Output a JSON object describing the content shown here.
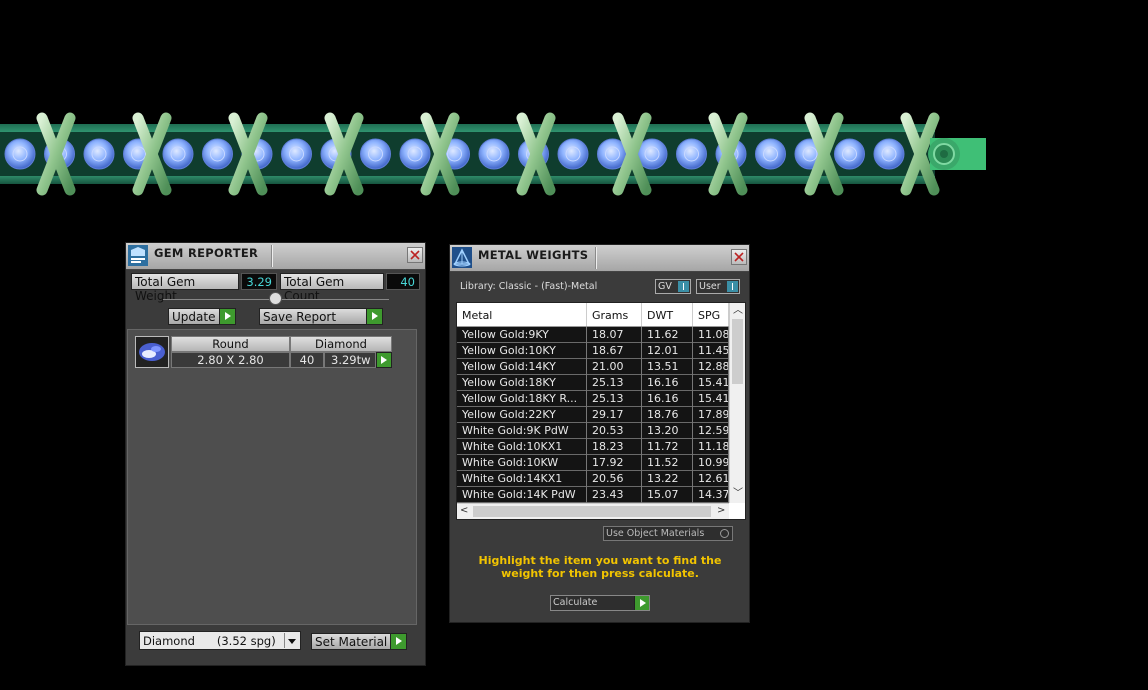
{
  "gem_reporter": {
    "title": "GEM REPORTER",
    "total_weight_label": "Total Gem Weight",
    "total_weight_value": "3.29",
    "total_count_label": "Total Gem Count",
    "total_count_value": "40",
    "update_label": "Update",
    "save_report_label": "Save Report",
    "gems": [
      {
        "shape": "Round",
        "material": "Diamond",
        "size": "2.80 X 2.80",
        "count": "40",
        "weight": "3.29tw"
      }
    ],
    "material_select": "Diamond      (3.52 spg)",
    "set_material_label": "Set Material"
  },
  "metal_weights": {
    "title": "METAL WEIGHTS",
    "library": "Library: Classic - (Fast)-Metal",
    "gv_label": "GV",
    "user_label": "User",
    "columns": [
      "Metal",
      "Grams",
      "DWT",
      "SPG"
    ],
    "rows": [
      [
        "Yellow Gold:9KY",
        "18.07",
        "11.62",
        "11.08"
      ],
      [
        "Yellow Gold:10KY",
        "18.67",
        "12.01",
        "11.45"
      ],
      [
        "Yellow Gold:14KY",
        "21.00",
        "13.51",
        "12.88"
      ],
      [
        "Yellow Gold:18KY",
        "25.13",
        "16.16",
        "15.41"
      ],
      [
        "Yellow Gold:18KY R...",
        "25.13",
        "16.16",
        "15.41"
      ],
      [
        "Yellow Gold:22KY",
        "29.17",
        "18.76",
        "17.89"
      ],
      [
        "White Gold:9K PdW",
        "20.53",
        "13.20",
        "12.59"
      ],
      [
        "White Gold:10KX1",
        "18.23",
        "11.72",
        "11.18"
      ],
      [
        "White Gold:10KW",
        "17.92",
        "11.52",
        "10.99"
      ],
      [
        "White Gold:14KX1",
        "20.56",
        "13.22",
        "12.61"
      ],
      [
        "White Gold:14K PdW",
        "23.43",
        "15.07",
        "14.37"
      ]
    ],
    "use_object_materials_label": "Use Object Materials",
    "instruction": "Highlight the item you want to find the weight for then press calculate.",
    "calculate_label": "Calculate"
  },
  "colors": {
    "accent_green": "#3e9a2e",
    "value_cyan": "#48d7d7",
    "instruction_yellow": "#f2c400",
    "bracelet_teal": "#2f9f7a",
    "gem_blue": "#8fb4ff"
  }
}
